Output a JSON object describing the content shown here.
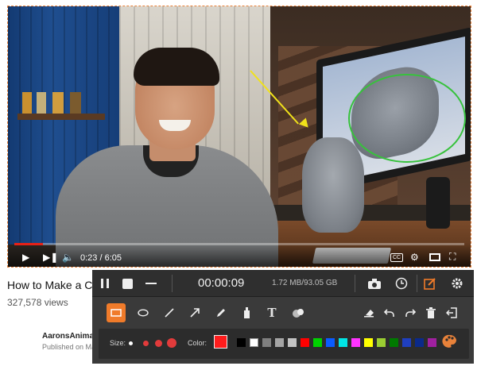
{
  "video": {
    "current_time": "0:23",
    "duration": "6:05",
    "time_display": "0:23 / 6:05",
    "progress_fraction": 0.063,
    "icons": [
      "play-icon",
      "next-icon",
      "volume-icon",
      "captions-icon",
      "settings-icon",
      "theater-icon",
      "fullscreen-icon"
    ]
  },
  "page": {
    "title": "How to Make a Cat V",
    "views": "327,578 views",
    "channel": "AaronsAnimals",
    "published": "Published on Ma"
  },
  "recorder": {
    "timer": "00:00:09",
    "size": "1.72 MB/93.05 GB",
    "top_icons": [
      "pause-icon",
      "stop-icon",
      "minimize-icon",
      "camera-icon",
      "clock-icon",
      "edit-icon",
      "gear-icon"
    ],
    "tools": [
      "rectangle-icon",
      "ellipse-icon",
      "line-icon",
      "arrow-icon",
      "pen-icon",
      "highlighter-icon",
      "text-icon",
      "callout-icon",
      "eraser-icon",
      "undo-icon",
      "redo-icon",
      "trash-icon",
      "exit-icon"
    ],
    "active_tool": "rectangle-icon",
    "options": {
      "size_label": "Size:",
      "color_label": "Color:",
      "current_color": "#ff1c1c",
      "palette_colors": [
        "#000000",
        "#ffffff",
        "#7f7f7f",
        "#a5a5a5",
        "#c3c3c3",
        "#ff0000",
        "#00d100",
        "#0a5cff",
        "#00e5e5",
        "#ff33ff",
        "#ffff00",
        "#9acd32",
        "#007a00",
        "#1f3fbf",
        "#0b2a8a",
        "#a020a0"
      ]
    }
  },
  "colors": {
    "accent": "#f07b2a",
    "annotation_green": "#37c23c",
    "annotation_arrow": "#f1e21a",
    "progress_red": "#e62117"
  }
}
